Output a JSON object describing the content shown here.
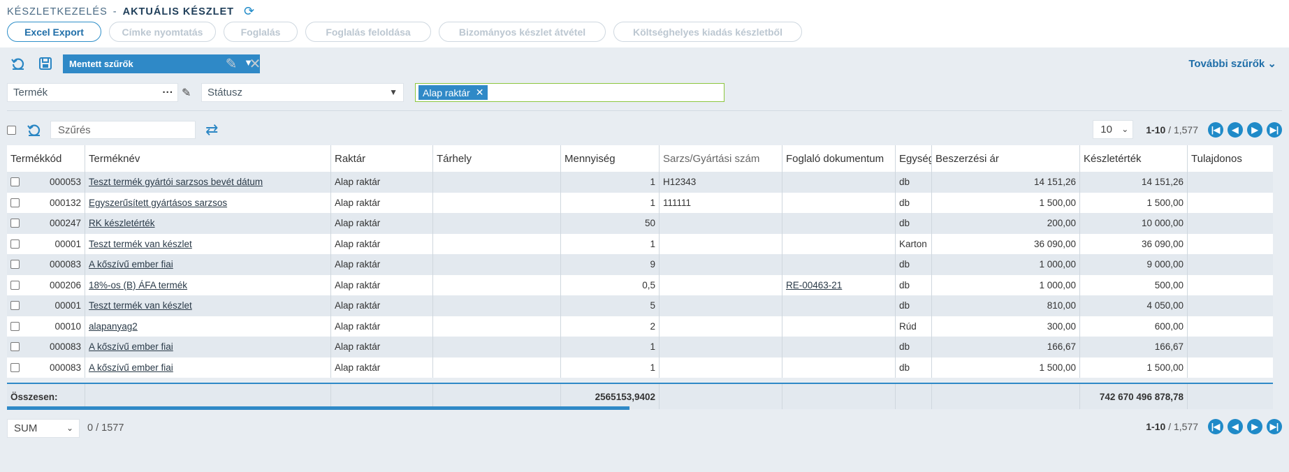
{
  "breadcrumb": {
    "section": "KÉSZLETKEZELÉS",
    "separator": "-",
    "page": "AKTUÁLIS KÉSZLET"
  },
  "actions": [
    "Excel Export",
    "Címke nyomtatás",
    "Foglalás",
    "Foglalás feloldása",
    "Bizományos készlet átvétel",
    "Költséghelyes kiadás készletből"
  ],
  "toolbar": {
    "saved_filters": "Mentett szűrők",
    "more_filters": "További szűrők"
  },
  "filters": {
    "product_placeholder": "Termék",
    "status_placeholder": "Státusz",
    "warehouse_tag": "Alap raktár"
  },
  "grid": {
    "search_placeholder": "Szűrés",
    "page_size": "10",
    "range": "1-10",
    "total": "/ 1,577",
    "columns": [
      "Termékkód",
      "Terméknév",
      "Raktár",
      "Tárhely",
      "Mennyiség",
      "Sarzs/Gyártási szám",
      "Foglaló dokumentum",
      "Egység",
      "Beszerzési ár",
      "Készletérték",
      "Tulajdonos"
    ],
    "rows": [
      {
        "code": "000053",
        "name": "Teszt termék gyártói sarzsos bevét dátum",
        "wh": "Alap raktár",
        "bin": "",
        "qty": "1",
        "batch": "H12343",
        "doc": "",
        "unit": "db",
        "price": "14 151,26",
        "value": "14 151,26",
        "owner": ""
      },
      {
        "code": "000132",
        "name": "Egyszerűsített gyártásos sarzsos",
        "wh": "Alap raktár",
        "bin": "",
        "qty": "1",
        "batch": "111111",
        "doc": "",
        "unit": "db",
        "price": "1 500,00",
        "value": "1 500,00",
        "owner": ""
      },
      {
        "code": "000247",
        "name": "RK készletérték",
        "wh": "Alap raktár",
        "bin": "",
        "qty": "50",
        "batch": "",
        "doc": "",
        "unit": "db",
        "price": "200,00",
        "value": "10 000,00",
        "owner": ""
      },
      {
        "code": "00001",
        "name": "Teszt termék van készlet",
        "wh": "Alap raktár",
        "bin": "",
        "qty": "1",
        "batch": "",
        "doc": "",
        "unit": "Karton",
        "price": "36 090,00",
        "value": "36 090,00",
        "owner": ""
      },
      {
        "code": "000083",
        "name": "A kőszívű ember fiai",
        "wh": "Alap raktár",
        "bin": "",
        "qty": "9",
        "batch": "",
        "doc": "",
        "unit": "db",
        "price": "1 000,00",
        "value": "9 000,00",
        "owner": ""
      },
      {
        "code": "000206",
        "name": "18%-os (B) ÁFA termék",
        "wh": "Alap raktár",
        "bin": "",
        "qty": "0,5",
        "batch": "",
        "doc": "RE-00463-21",
        "unit": "db",
        "price": "1 000,00",
        "value": "500,00",
        "owner": ""
      },
      {
        "code": "00001",
        "name": "Teszt termék van készlet",
        "wh": "Alap raktár",
        "bin": "",
        "qty": "5",
        "batch": "",
        "doc": "",
        "unit": "db",
        "price": "810,00",
        "value": "4 050,00",
        "owner": ""
      },
      {
        "code": "00010",
        "name": "alapanyag2",
        "wh": "Alap raktár",
        "bin": "",
        "qty": "2",
        "batch": "",
        "doc": "",
        "unit": "Rúd",
        "price": "300,00",
        "value": "600,00",
        "owner": ""
      },
      {
        "code": "000083",
        "name": "A kőszívű ember fiai",
        "wh": "Alap raktár",
        "bin": "",
        "qty": "1",
        "batch": "",
        "doc": "",
        "unit": "db",
        "price": "166,67",
        "value": "166,67",
        "owner": ""
      },
      {
        "code": "000083",
        "name": "A kőszívű ember fiai",
        "wh": "Alap raktár",
        "bin": "",
        "qty": "1",
        "batch": "",
        "doc": "",
        "unit": "db",
        "price": "1 500,00",
        "value": "1 500,00",
        "owner": ""
      }
    ],
    "totals": {
      "label": "Összesen:",
      "qty": "2565153,9402",
      "value": "742 670 496 878,78"
    }
  },
  "footer": {
    "aggregate": "SUM",
    "selected": "0",
    "slash": "/",
    "count": "1577",
    "range": "1-10",
    "total": "/ 1,577"
  }
}
